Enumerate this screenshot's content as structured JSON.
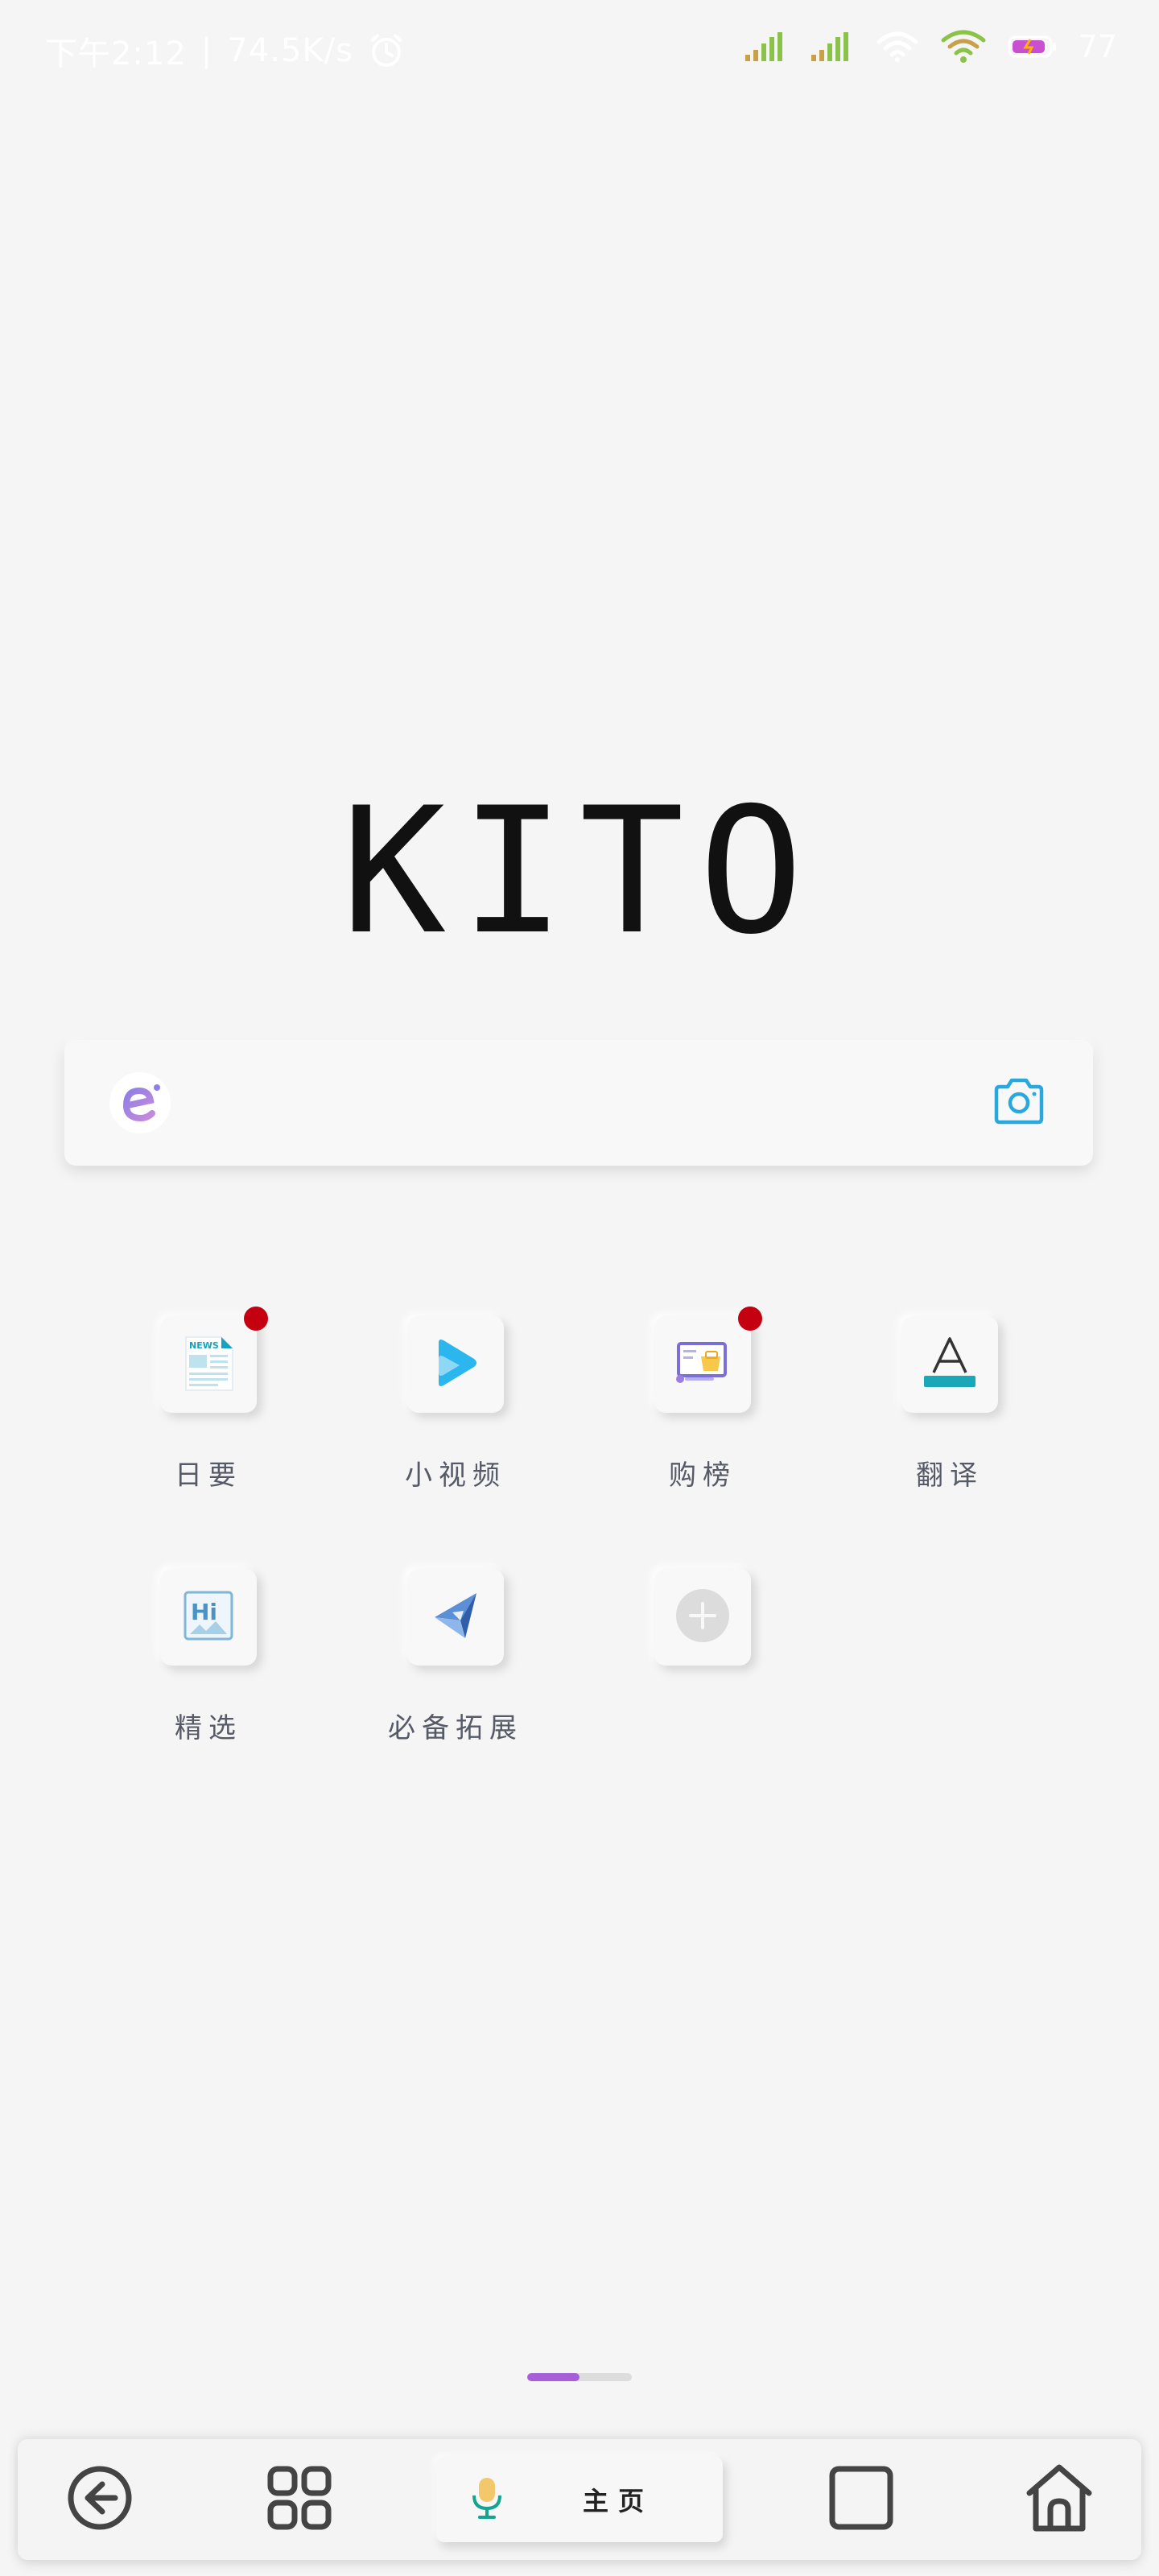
{
  "status_bar": {
    "time": "下午2:12",
    "network_speed": "74.5K/s",
    "battery_level": "77",
    "icons": [
      "alarm-icon",
      "signal-icon",
      "signal-icon",
      "wifi-icon",
      "wifi-icon",
      "battery-icon"
    ]
  },
  "logo": {
    "text": "KITO"
  },
  "search": {
    "placeholder": "",
    "value": "",
    "engine_icon": "engine-logo-icon",
    "camera_icon": "camera-icon"
  },
  "shortcuts": [
    {
      "label": "日要",
      "icon": "news-icon",
      "badge": true
    },
    {
      "label": "小视频",
      "icon": "play-icon",
      "badge": false
    },
    {
      "label": "购榜",
      "icon": "shopping-icon",
      "badge": true
    },
    {
      "label": "翻译",
      "icon": "translate-icon",
      "badge": false
    },
    {
      "label": "精选",
      "icon": "hi-icon",
      "badge": false
    },
    {
      "label": "必备拓展",
      "icon": "extension-icon",
      "badge": false
    },
    {
      "label": "",
      "icon": "add-icon",
      "badge": false
    }
  ],
  "page_indicator": {
    "current_fraction": 0.5
  },
  "bottom_nav": {
    "home_label": "主页",
    "items": [
      "back-icon",
      "apps-grid-icon",
      "microphone-icon",
      "tabs-icon",
      "home-icon"
    ]
  },
  "colors": {
    "background": "#f5f5f5",
    "badge": "#c50010",
    "accent_purple": "#a75fd9",
    "camera_blue": "#29a8de",
    "translate_teal": "#1aa7b8"
  }
}
